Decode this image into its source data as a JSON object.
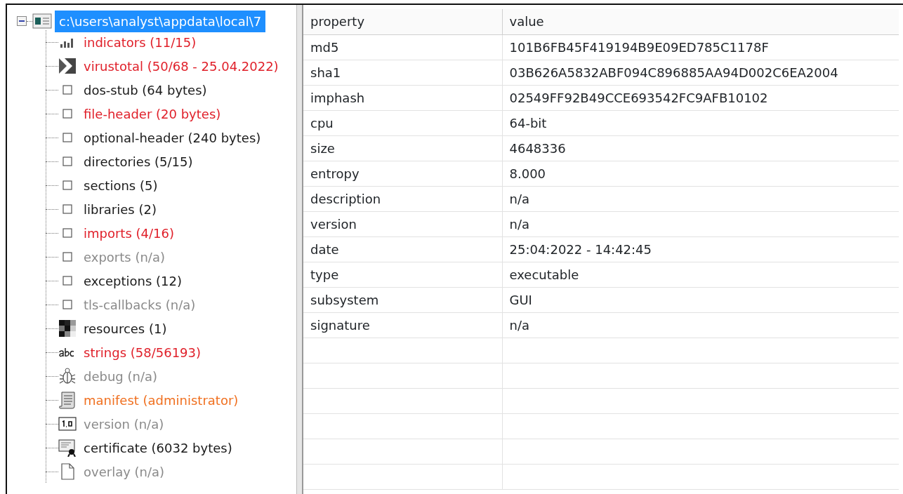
{
  "tree": {
    "root": {
      "label": "c:\\users\\analyst\\appdata\\local\\7",
      "selected": true,
      "expanded": true
    },
    "children": [
      {
        "label": "indicators (11/15)",
        "kind": "chart",
        "color": "#e0202a"
      },
      {
        "label": "virustotal (50/68 - 25.04.2022)",
        "kind": "virustotal",
        "color": "#e0202a"
      },
      {
        "label": "dos-stub (64 bytes)",
        "kind": "plain",
        "color": "#1a1a1a"
      },
      {
        "label": "file-header (20 bytes)",
        "kind": "plain",
        "color": "#e0202a"
      },
      {
        "label": "optional-header (240 bytes)",
        "kind": "plain",
        "color": "#1a1a1a"
      },
      {
        "label": "directories (5/15)",
        "kind": "plain",
        "color": "#1a1a1a"
      },
      {
        "label": "sections (5)",
        "kind": "plain",
        "color": "#1a1a1a"
      },
      {
        "label": "libraries (2)",
        "kind": "plain",
        "color": "#1a1a1a"
      },
      {
        "label": "imports (4/16)",
        "kind": "plain",
        "color": "#e0202a"
      },
      {
        "label": "exports (n/a)",
        "kind": "plain",
        "color": "#8a8a8a"
      },
      {
        "label": "exceptions (12)",
        "kind": "plain",
        "color": "#1a1a1a"
      },
      {
        "label": "tls-callbacks (n/a)",
        "kind": "plain",
        "color": "#8a8a8a"
      },
      {
        "label": "resources (1)",
        "kind": "resources",
        "color": "#1a1a1a"
      },
      {
        "label": "strings (58/56193)",
        "kind": "strings",
        "color": "#e0202a"
      },
      {
        "label": "debug (n/a)",
        "kind": "debug",
        "color": "#8a8a8a"
      },
      {
        "label": "manifest (administrator)",
        "kind": "manifest",
        "color": "#f07020"
      },
      {
        "label": "version (n/a)",
        "kind": "version",
        "color": "#8a8a8a"
      },
      {
        "label": "certificate (6032 bytes)",
        "kind": "certificate",
        "color": "#1a1a1a"
      },
      {
        "label": "overlay (n/a)",
        "kind": "overlay",
        "color": "#8a8a8a"
      }
    ]
  },
  "table": {
    "columns": [
      "property",
      "value"
    ],
    "rows": [
      [
        "md5",
        "101B6FB45F419194B9E09ED785C1178F"
      ],
      [
        "sha1",
        "03B626A5832ABF094C896885AA94D002C6EA2004"
      ],
      [
        "imphash",
        "02549FF92B49CCE693542FC9AFB10102"
      ],
      [
        "cpu",
        "64-bit"
      ],
      [
        "size",
        "4648336"
      ],
      [
        "entropy",
        "8.000"
      ],
      [
        "description",
        "n/a"
      ],
      [
        "version",
        "n/a"
      ],
      [
        "date",
        "25:04:2022 - 14:42:45"
      ],
      [
        "type",
        "executable"
      ],
      [
        "subsystem",
        "GUI"
      ],
      [
        "signature",
        "n/a"
      ]
    ]
  }
}
